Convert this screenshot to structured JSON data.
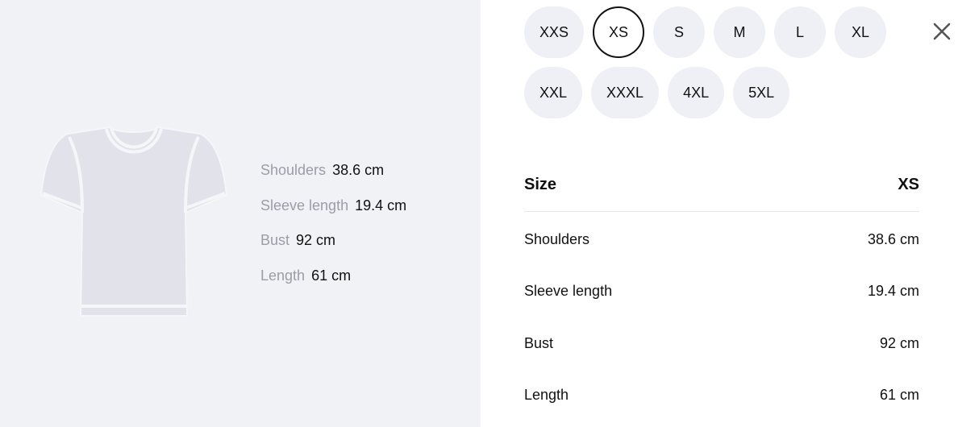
{
  "sizes": {
    "row1": [
      "XXS",
      "XS",
      "S",
      "M",
      "L",
      "XL"
    ],
    "row2": [
      "XXL",
      "XXXL",
      "4XL",
      "5XL"
    ],
    "selected": "XS"
  },
  "close": {
    "icon": "close-icon"
  },
  "garment": {
    "icon": "tshirt-icon",
    "measurements": [
      {
        "label": "Shoulders",
        "value": "38.6 cm"
      },
      {
        "label": "Sleeve length",
        "value": "19.4 cm"
      },
      {
        "label": "Bust",
        "value": "92 cm"
      },
      {
        "label": "Length",
        "value": "61 cm"
      }
    ]
  },
  "table": {
    "header_label": "Size",
    "header_value": "XS",
    "rows": [
      {
        "label": "Shoulders",
        "value": "38.6 cm"
      },
      {
        "label": "Sleeve length",
        "value": "19.4 cm"
      },
      {
        "label": "Bust",
        "value": "92 cm"
      },
      {
        "label": "Length",
        "value": "61 cm"
      }
    ]
  },
  "colors": {
    "panel_bg": "#f1f2f6",
    "chip_bg": "#eff0f5",
    "muted_text": "#9b9da7",
    "selected_border": "#111111"
  }
}
